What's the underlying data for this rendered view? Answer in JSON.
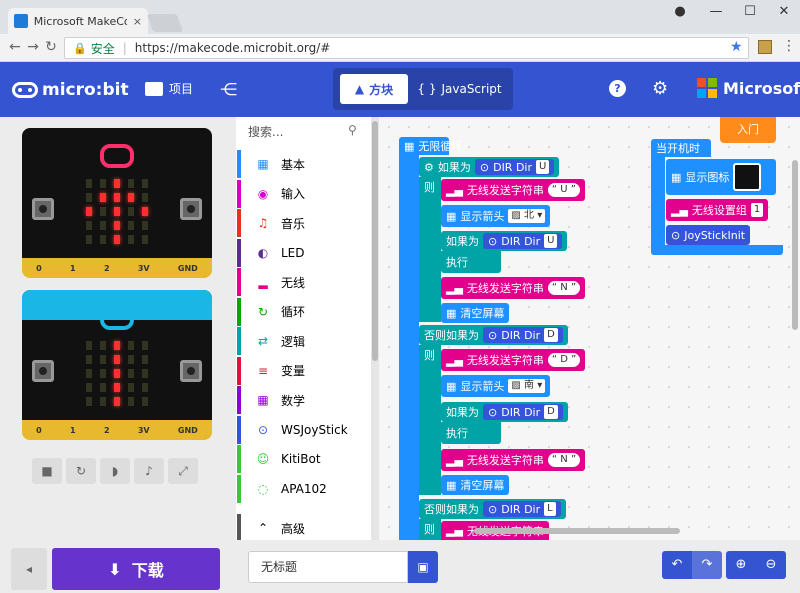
{
  "browser": {
    "tab_title": "Microsoft MakeCode fo",
    "tab_close": "×",
    "secure_label": "安全",
    "url": "https://makecode.microbit.org/#",
    "win_min": "—",
    "win_max": "☐",
    "win_close": "✕",
    "user": "●"
  },
  "header": {
    "logo_text": "micro:bit",
    "projects_label": "项目",
    "mode_blocks": "方块",
    "mode_js": "JavaScript",
    "help": "?",
    "brand": "Microsoft"
  },
  "simulator": {
    "pins": [
      "0",
      "1",
      "2",
      "3V",
      "GND"
    ],
    "board1_leds": [
      0,
      0,
      1,
      0,
      0,
      0,
      1,
      1,
      1,
      0,
      1,
      0,
      1,
      0,
      1,
      0,
      0,
      1,
      0,
      0,
      0,
      0,
      1,
      0,
      0
    ],
    "board2_leds": [
      0,
      0,
      1,
      0,
      0,
      0,
      0,
      1,
      0,
      0,
      0,
      0,
      1,
      0,
      0,
      0,
      0,
      1,
      0,
      0,
      0,
      0,
      1,
      0,
      0
    ]
  },
  "toolbox": {
    "search_placeholder": "搜索...",
    "categories": [
      {
        "label": "基本",
        "color": "#1e90ff",
        "icon": "▦"
      },
      {
        "label": "输入",
        "color": "#d400d4",
        "icon": "◉"
      },
      {
        "label": "音乐",
        "color": "#e63022",
        "icon": "♫"
      },
      {
        "label": "LED",
        "color": "#5c2d91",
        "icon": "◐"
      },
      {
        "label": "无线",
        "color": "#e3008c",
        "icon": "▂"
      },
      {
        "label": "循环",
        "color": "#00aa00",
        "icon": "↻"
      },
      {
        "label": "逻辑",
        "color": "#00a4a6",
        "icon": "⇄"
      },
      {
        "label": "变量",
        "color": "#dc143c",
        "icon": "≡"
      },
      {
        "label": "数学",
        "color": "#9400d3",
        "icon": "▦"
      },
      {
        "label": "WSJoyStick",
        "color": "#3455db",
        "icon": "⊙"
      },
      {
        "label": "KitiBot",
        "color": "#32cd32",
        "icon": "☺"
      },
      {
        "label": "APA102",
        "color": "#32cd32",
        "icon": "◌"
      }
    ],
    "advanced_label": "高级"
  },
  "workspace": {
    "intro_button": "入门",
    "forever": "无限循环",
    "if": "如果为",
    "then": "则",
    "else_if": "否则如果为",
    "exec": "执行",
    "dir_label": "DIR Dir",
    "dir_U": "U",
    "dir_D": "D",
    "dir_L": "L",
    "radio_send": "无线发送字符串",
    "str_U": "U",
    "str_N": "N",
    "str_D": "D",
    "show_arrow": "显示箭头",
    "arrow_north": "北",
    "arrow_south": "南",
    "clear": "清空屏幕",
    "on_start": "当开机时",
    "show_icon": "显示图标",
    "radio_group": "无线设置组",
    "group_value": "1",
    "joystick_init": "JoyStickInit"
  },
  "footer": {
    "download": "下载",
    "project_name": "无标题"
  }
}
